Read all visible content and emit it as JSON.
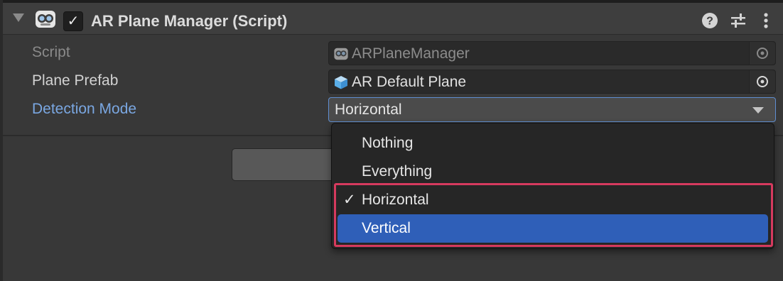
{
  "component": {
    "title": "AR Plane Manager (Script)",
    "enabled": true,
    "header_icons": [
      "help-icon",
      "presets-icon",
      "more-icon"
    ]
  },
  "fields": {
    "script": {
      "label": "Script",
      "value": "ARPlaneManager",
      "icon": "script-icon"
    },
    "plane_prefab": {
      "label": "Plane Prefab",
      "value": "AR Default Plane",
      "icon": "prefab-cube-icon"
    },
    "detection_mode": {
      "label": "Detection Mode",
      "value": "Horizontal"
    }
  },
  "dropdown_menu": {
    "items": [
      {
        "label": "Nothing",
        "checked": false,
        "hovered": false
      },
      {
        "label": "Everything",
        "checked": false,
        "hovered": false
      },
      {
        "label": "Horizontal",
        "checked": true,
        "hovered": false
      },
      {
        "label": "Vertical",
        "checked": false,
        "hovered": true
      }
    ],
    "check_glyph": "✓"
  },
  "colors": {
    "panel_bg": "#383838",
    "header_bg": "#3e3e3e",
    "focused_label": "#7aa7e2",
    "menu_bg": "#262626",
    "menu_hover": "#2f5fb8",
    "highlight_annotation": "#d63a5e"
  }
}
